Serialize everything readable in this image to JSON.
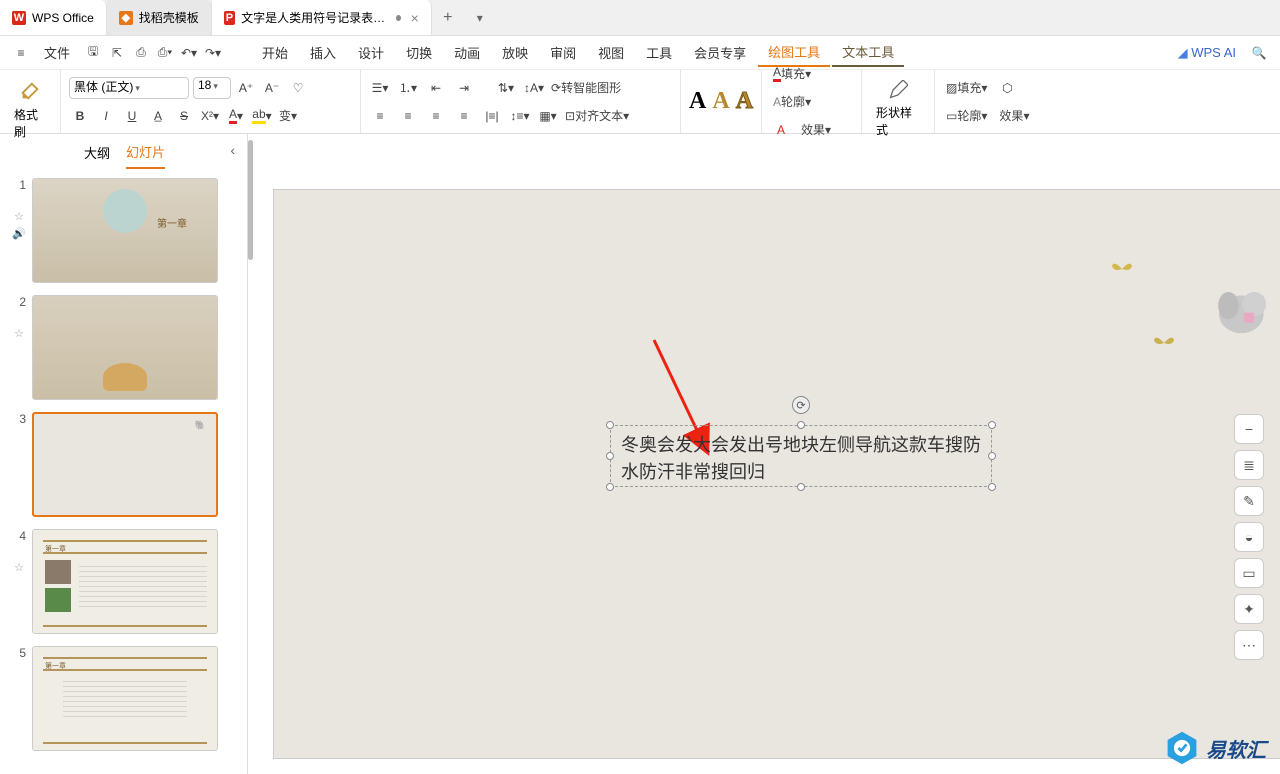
{
  "tabs": {
    "t1": {
      "label": "WPS Office",
      "color": "#d9291c"
    },
    "t2": {
      "label": "找稻壳模板",
      "color": "#e67717"
    },
    "t3": {
      "label": "文字是人类用符号记录表达信息以",
      "color": "#d9291c"
    }
  },
  "menu": {
    "hamburger": "≡",
    "file": "文件",
    "items": [
      "开始",
      "插入",
      "设计",
      "切换",
      "动画",
      "放映",
      "审阅",
      "视图",
      "工具",
      "会员专享",
      "绘图工具",
      "文本工具"
    ],
    "wpsai": "WPS AI"
  },
  "toolbar": {
    "format_brush": "格式刷",
    "font_name": "黑体 (正文)",
    "font_size": "18",
    "smart_shape": "转智能图形",
    "align_text": "对齐文本",
    "fill": "填充",
    "outline": "轮廓",
    "effect": "效果",
    "shape_style": "形状样式",
    "wa_letter": "A"
  },
  "outline": {
    "tab_outline": "大纲",
    "tab_slides": "幻灯片"
  },
  "thumbs": {
    "n1": "1",
    "n2": "2",
    "n3": "3",
    "n4": "4",
    "n5": "5"
  },
  "textbox": {
    "content": "冬奥会发大会发出号地块左侧导航这款车搜防水防汗非常搜回归",
    "rotate_glyph": "⟳"
  },
  "side_tools": {
    "minus": "−",
    "layers": "≣",
    "pen": "✎",
    "paint": "◒",
    "screen": "▭",
    "magic": "✦",
    "more": "⋯"
  },
  "watermark": {
    "text": "易软汇"
  }
}
